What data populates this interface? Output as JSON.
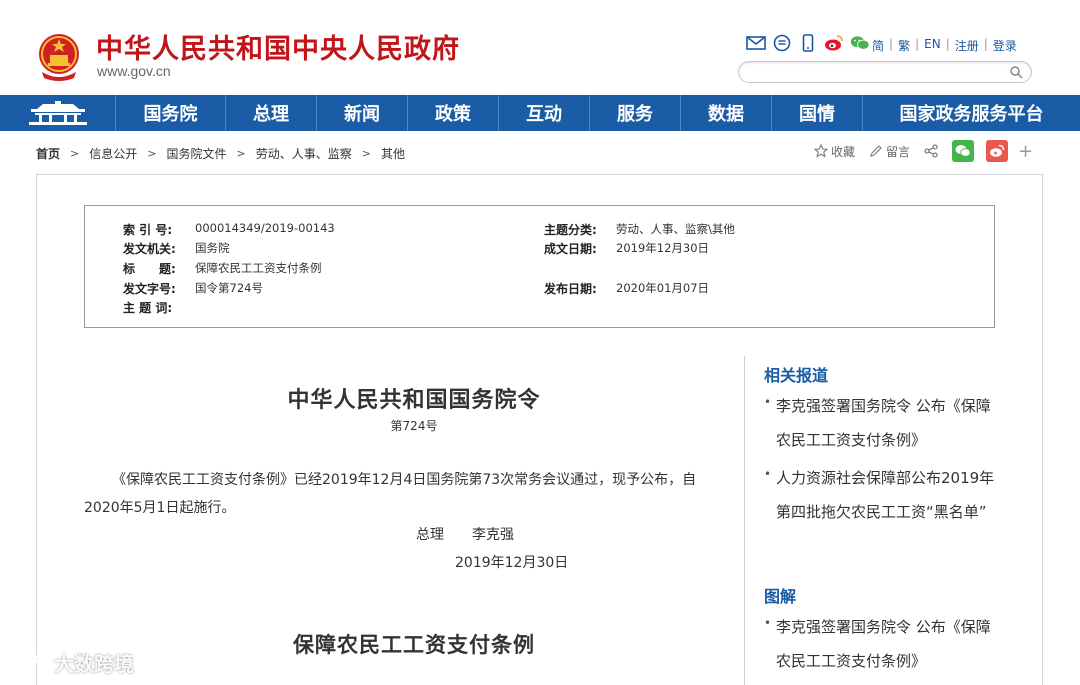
{
  "header": {
    "site_title": "中华人民共和国中央人民政府",
    "site_url": "www.gov.cn",
    "top_links": [
      "简",
      "繁",
      "EN",
      "注册",
      "登录"
    ],
    "search_placeholder": ""
  },
  "nav": {
    "items": [
      "国务院",
      "总理",
      "新闻",
      "政策",
      "互动",
      "服务",
      "数据",
      "国情",
      "国家政务服务平台"
    ]
  },
  "breadcrumb": [
    "首页",
    "信息公开",
    "国务院文件",
    "劳动、人事、监察",
    "其他"
  ],
  "tools": {
    "favorite": "收藏",
    "comment": "留言",
    "more": "+"
  },
  "meta": {
    "index_label": "索 引 号:",
    "index_value": "000014349/2019-00143",
    "topic_label": "主题分类:",
    "topic_value": "劳动、人事、监察\\其他",
    "issuer_label": "发文机关:",
    "issuer_value": "国务院",
    "written_label": "成文日期:",
    "written_value": "2019年12月30日",
    "title_label": "标　　题:",
    "title_value": "保障农民工工资支付条例",
    "docno_label": "发文字号:",
    "docno_value": "国令第724号",
    "publish_label": "发布日期:",
    "publish_value": "2020年01月07日",
    "subject_label": "主 题 词:",
    "subject_value": ""
  },
  "article": {
    "title": "中华人民共和国国务院令",
    "number": "第724号",
    "body": "《保障农民工工资支付条例》已经2019年12月4日国务院第73次常务会议通过，现予公布，自2020年5月1日起施行。",
    "signature": "总理　　李克强",
    "date": "2019年12月30日",
    "title2": "保障农民工工资支付条例"
  },
  "sidebar": {
    "related_heading": "相关报道",
    "related_items": [
      "李克强签署国务院令 公布《保障农民工工资支付条例》",
      "人力资源社会保障部公布2019年第四批拖欠农民工工资“黑名单”"
    ],
    "graphic_heading": "图解",
    "graphic_items": [
      "李克强签署国务院令 公布《保障农民工工资支付条例》"
    ]
  },
  "watermark": "大数跨境",
  "colors": {
    "brand_red": "#c0161b",
    "nav_blue": "#1a5ca6",
    "link_blue": "#1a57a3"
  }
}
